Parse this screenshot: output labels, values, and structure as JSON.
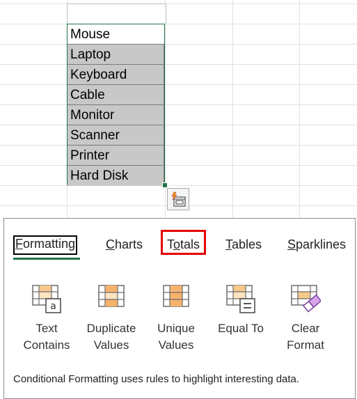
{
  "sheet": {
    "cells": [
      "Mouse",
      "Laptop",
      "Keyboard",
      "Cable",
      "Monitor",
      "Scanner",
      "Printer",
      "Hard Disk"
    ],
    "selection_color": "#217346",
    "highlight_color": "#c8c8c8"
  },
  "quick_analysis": {
    "button_icon": "quick-analysis-icon",
    "tabs": [
      {
        "label_pre": "",
        "accel": "F",
        "label_post": "ormatting"
      },
      {
        "label_pre": "",
        "accel": "C",
        "label_post": "harts"
      },
      {
        "label_pre": "T",
        "accel": "o",
        "label_post": "tals"
      },
      {
        "label_pre": "",
        "accel": "T",
        "label_post": "ables"
      },
      {
        "label_pre": "",
        "accel": "S",
        "label_post": "parklines"
      }
    ],
    "active_tab": "Formatting",
    "highlighted_tab": "Totals",
    "options": [
      {
        "line1": "Text",
        "line2": "Contains",
        "icon": "text-contains-icon"
      },
      {
        "line1": "Duplicate",
        "line2": "Values",
        "icon": "duplicate-values-icon"
      },
      {
        "line1": "Unique",
        "line2": "Values",
        "icon": "unique-values-icon"
      },
      {
        "line1": "Equal To",
        "line2": "",
        "icon": "equal-to-icon"
      },
      {
        "line1": "Clear",
        "line2": "Format",
        "icon": "clear-format-icon"
      }
    ],
    "description": "Conditional Formatting uses rules to highlight interesting data."
  }
}
